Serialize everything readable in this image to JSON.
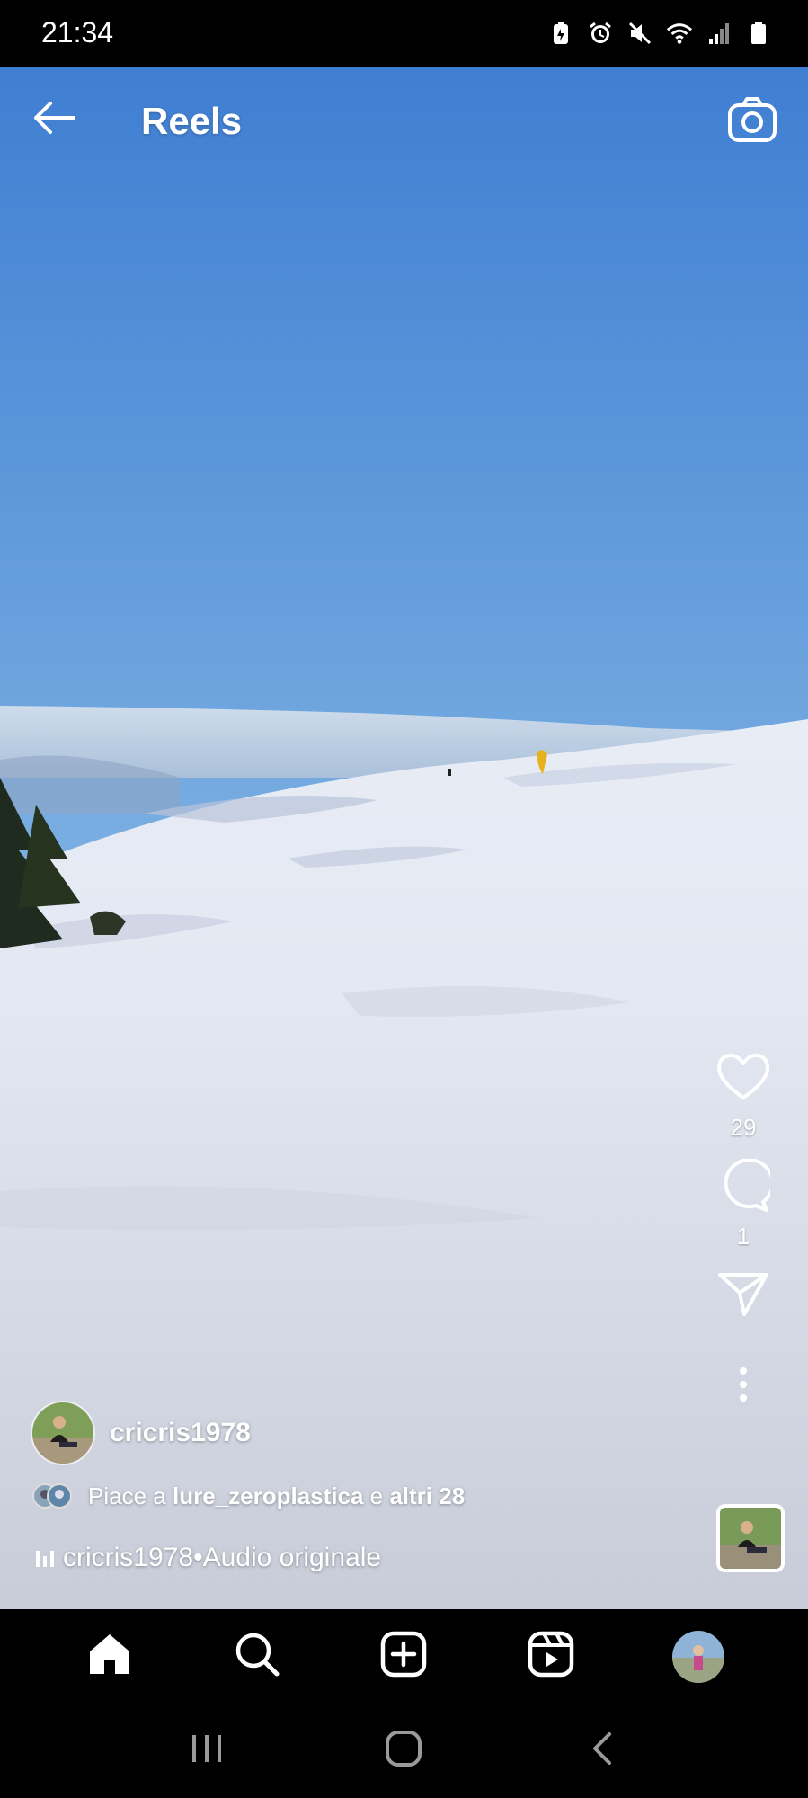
{
  "status_bar": {
    "time": "21:34",
    "icons": [
      "battery-saver-icon",
      "alarm-icon",
      "mute-icon",
      "wifi-icon",
      "signal-icon",
      "battery-icon"
    ]
  },
  "header": {
    "title": "Reels",
    "back_icon": "arrow-left-icon",
    "camera_icon": "camera-icon"
  },
  "actions": {
    "like_count": "29",
    "comment_count": "1",
    "icons": [
      "heart-icon",
      "comment-icon",
      "share-icon",
      "more-icon"
    ]
  },
  "post": {
    "username": "cricris1978",
    "likes_prefix": "Piace a",
    "likes_user": "lure_zeroplastica",
    "likes_joiner": "e",
    "likes_others": "altri 28",
    "audio_user": "cricris1978",
    "audio_separator": "•",
    "audio_label": "Audio originale"
  },
  "bottom_nav": {
    "items": [
      "home-icon",
      "search-icon",
      "create-icon",
      "reels-icon",
      "profile-avatar"
    ]
  },
  "system_nav": {
    "items": [
      "recents-icon",
      "home-icon",
      "back-icon"
    ]
  },
  "colors": {
    "sky_top": "#3f7ed2",
    "sky_bottom": "#9cc7ea",
    "snow": "#e4e8f2",
    "snow_shadow": "#b8c0d6",
    "kite": "#e6b21e",
    "bars": "#000000"
  }
}
